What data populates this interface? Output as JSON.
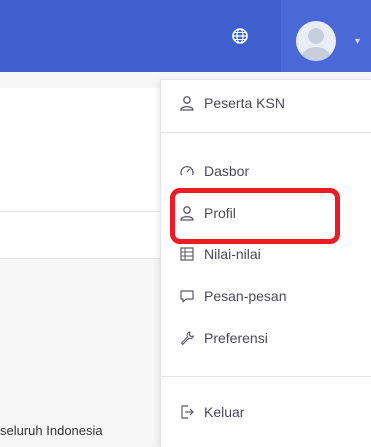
{
  "header": {
    "globe_icon": "globe-icon",
    "avatar_icon": "user-avatar",
    "caret_icon": "chevron-down-icon",
    "bg_color": "#3f5fcf"
  },
  "background": {
    "footer_text": "seluruh Indonesia"
  },
  "user_menu": {
    "role_item": {
      "label": "Peserta KSN",
      "icon": "user-icon"
    },
    "items": [
      {
        "label": "Dasbor",
        "icon": "gauge-icon"
      },
      {
        "label": "Profil",
        "icon": "user-icon",
        "highlighted": true
      },
      {
        "label": "Nilai-nilai",
        "icon": "grades-table-icon"
      },
      {
        "label": "Pesan-pesan",
        "icon": "speech-bubble-icon"
      },
      {
        "label": "Preferensi",
        "icon": "wrench-icon"
      }
    ],
    "logout_item": {
      "label": "Keluar",
      "icon": "logout-icon"
    }
  },
  "annotation": {
    "color": "#ec1c24"
  }
}
